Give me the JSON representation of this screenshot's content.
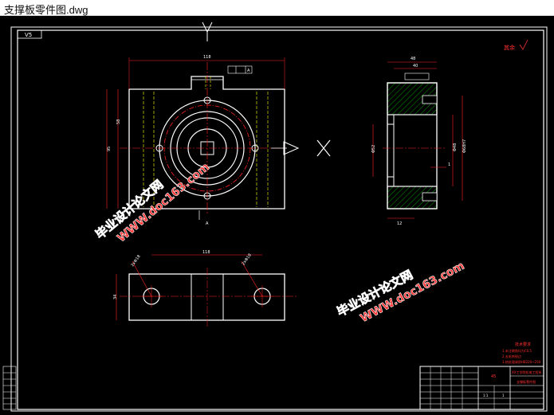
{
  "window": {
    "title": "支撑板零件图.dwg"
  },
  "drawing": {
    "colors": {
      "background": "#000000",
      "outline": "#ffffff",
      "dimension": "#ff2020",
      "centerline": "#ff2020",
      "hidden": "#e0e000",
      "hatch": "#00c000",
      "watermark": "#ff3030",
      "border_inner": "#ffffff"
    },
    "corner_tag": "V5",
    "roughness_note": "其余",
    "tech_requirements": {
      "title": "技术要求",
      "lines": [
        "1.未注倒角均为C0.5",
        "2.去毛刺锐边",
        "3.热处理调质HB220~250"
      ]
    },
    "title_block": {
      "part_name": "支撑板",
      "school": "XX工学院机电工程系",
      "material": "45",
      "drawing_no": "支撑板零件图",
      "scale": "1:1",
      "sheet": "1"
    },
    "views": {
      "view_arrow_label": "A",
      "cut_label": "A",
      "datum_label": "A",
      "dims": {
        "top_width": "118",
        "left_height": "58",
        "left_total": "95",
        "bottom_hole": "2xΦ18",
        "bottom_hole_right": "2xΦ18",
        "bottom_height": "34",
        "side_top": "48",
        "side_top2": "40",
        "side_right1": "Φ48",
        "side_right2": "Φ68H7",
        "side_dia": "Φ52",
        "side_small": "1",
        "side_bottom": "12"
      }
    },
    "watermarks": [
      {
        "line1": "毕业设计论文网",
        "line2": "WWW.doc163.com"
      },
      {
        "line1": "毕业设计论文网",
        "line2": "WWW.doc163.com"
      }
    ]
  }
}
